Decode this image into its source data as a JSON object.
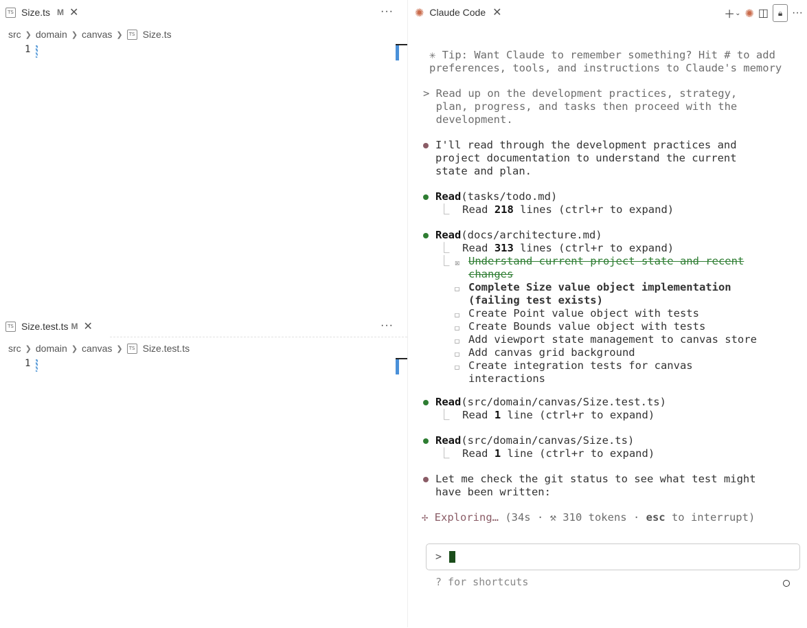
{
  "editors": [
    {
      "tab_label": "Size.ts",
      "tab_icon": "TS",
      "tab_modified": "M",
      "breadcrumb": [
        "src",
        "domain",
        "canvas",
        "Size.ts"
      ],
      "line_number": "1"
    },
    {
      "tab_label": "Size.test.ts",
      "tab_icon": "TS",
      "tab_modified": "M",
      "breadcrumb": [
        "src",
        "domain",
        "canvas",
        "Size.test.ts"
      ],
      "line_number": "1"
    }
  ],
  "more_label": "···",
  "claude": {
    "tab_label": "Claude Code",
    "tip": [
      "✳ Tip: Want Claude to remember something? Hit # to add",
      "preferences, tools, and instructions to Claude's memory"
    ],
    "user_prompt": [
      "> Read up on the development practices, strategy,",
      "  plan, progress, and tasks then proceed with the",
      "  development."
    ],
    "msg1": [
      "I'll read through the development practices and",
      "project documentation to understand the current",
      "state and plan."
    ],
    "tool1": {
      "name": "Read",
      "arg": "(tasks/todo.md)",
      "result_pre": "Read ",
      "result_num": "218",
      "result_post": " lines (ctrl+r to expand)"
    },
    "tool2": {
      "name": "Read",
      "arg": "(docs/architecture.md)",
      "result_pre": "Read ",
      "result_num": "313",
      "result_post": " lines (ctrl+r to expand)"
    },
    "todos": {
      "done": [
        "Understand current project state and recent",
        "changes"
      ],
      "in_progress": [
        "Complete Size value object implementation",
        "(failing test exists)"
      ],
      "pending": [
        "Create Point value object with tests",
        "Create Bounds value object with tests",
        "Add viewport state management to canvas store",
        "Add canvas grid background",
        "Create integration tests for canvas",
        "interactions"
      ]
    },
    "tool3": {
      "name": "Read",
      "arg": "(src/domain/canvas/Size.test.ts)",
      "result_pre": "Read ",
      "result_num": "1",
      "result_post": " line (ctrl+r to expand)"
    },
    "tool4": {
      "name": "Read",
      "arg": "(src/domain/canvas/Size.ts)",
      "result_pre": "Read ",
      "result_num": "1",
      "result_post": " line (ctrl+r to expand)"
    },
    "msg2": [
      "Let me check the git status to see what test might",
      "have been written:"
    ],
    "status": {
      "verb": "✢ Exploring…",
      "detail_pre": " (34s · ⚒ 310 tokens · ",
      "key": "esc",
      "detail_post": " to interrupt)"
    },
    "input_prompt": ">",
    "shortcuts_hint": "? for shortcuts"
  }
}
